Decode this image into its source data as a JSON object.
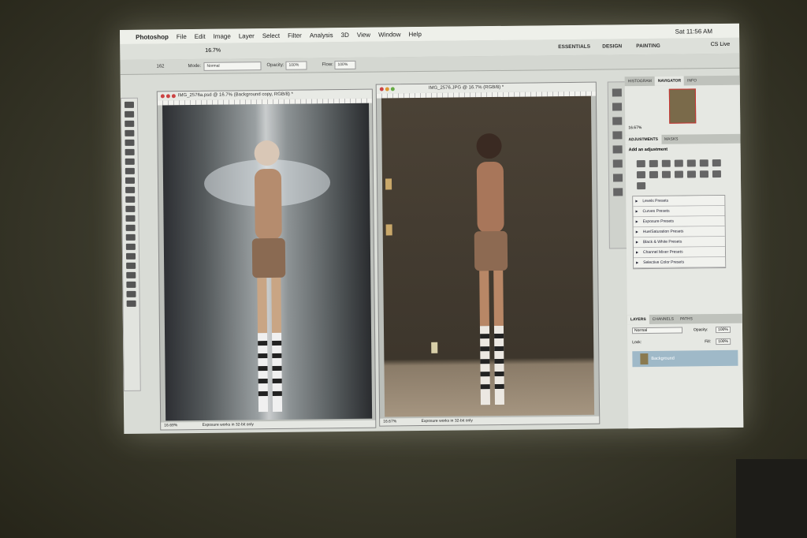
{
  "menubar": {
    "app": "Photoshop",
    "items": [
      "File",
      "Edit",
      "Image",
      "Layer",
      "Select",
      "Filter",
      "Analysis",
      "3D",
      "View",
      "Window",
      "Help"
    ],
    "clock": "Sat 11:56 AM"
  },
  "appbar": {
    "zoom": "16.7%",
    "workspaces": [
      "ESSENTIALS",
      "DESIGN",
      "PAINTING"
    ],
    "cs_live": "CS Live"
  },
  "options": {
    "mode_label": "Mode:",
    "mode_value": "Normal",
    "opacity_label": "Opacity:",
    "opacity_value": "100%",
    "flow_label": "Flow:",
    "flow_value": "100%",
    "brush_size": "162"
  },
  "doc1": {
    "title": "IMG_2576a.psd @ 16.7% (Background copy, RGB/8) *",
    "zoom": "16.69%",
    "status": "Exposure works in 32-bit only"
  },
  "doc2": {
    "title": "IMG_2576.JPG @ 16.7% (RGB/8) *",
    "zoom": "16.67%",
    "status": "Exposure works in 32-bit only"
  },
  "nav": {
    "tabs": [
      "HISTOGRAM",
      "NAVIGATOR",
      "INFO"
    ],
    "zoom": "16.67%"
  },
  "adjustments": {
    "tabs": [
      "ADJUSTMENTS",
      "MASKS"
    ],
    "heading": "Add an adjustment",
    "presets": [
      "Levels Presets",
      "Curves Presets",
      "Exposure Presets",
      "Hue/Saturation Presets",
      "Black & White Presets",
      "Channel Mixer Presets",
      "Selective Color Presets"
    ]
  },
  "layers": {
    "tabs": [
      "LAYERS",
      "CHANNELS",
      "PATHS"
    ],
    "blend": "Normal",
    "opacity_label": "Opacity:",
    "opacity": "100%",
    "lock_label": "Lock:",
    "fill_label": "Fill:",
    "fill": "100%",
    "layer_name": "Background"
  }
}
